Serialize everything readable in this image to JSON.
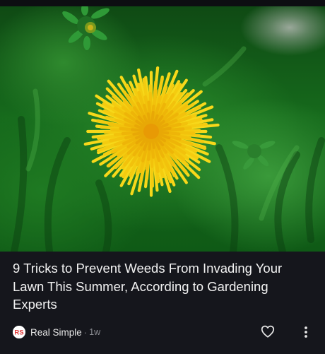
{
  "article": {
    "headline": "9 Tricks to Prevent Weeds From Invading Your Lawn This Summer, According to Gardening Experts",
    "source_name": "Real Simple",
    "source_logo_text": "RS",
    "separator": "·",
    "time_ago": "1w"
  },
  "image": {
    "subject": "yellow dandelion flower on green grass"
  },
  "actions": {
    "like_icon": "heart-outline-icon",
    "more_icon": "more-vertical-icon"
  },
  "colors": {
    "card_background": "#15161c",
    "headline_text": "#f2f2f2",
    "meta_text": "#8b8c92",
    "logo_accent": "#e23a3a",
    "flower_yellow": "#f5d20a"
  }
}
